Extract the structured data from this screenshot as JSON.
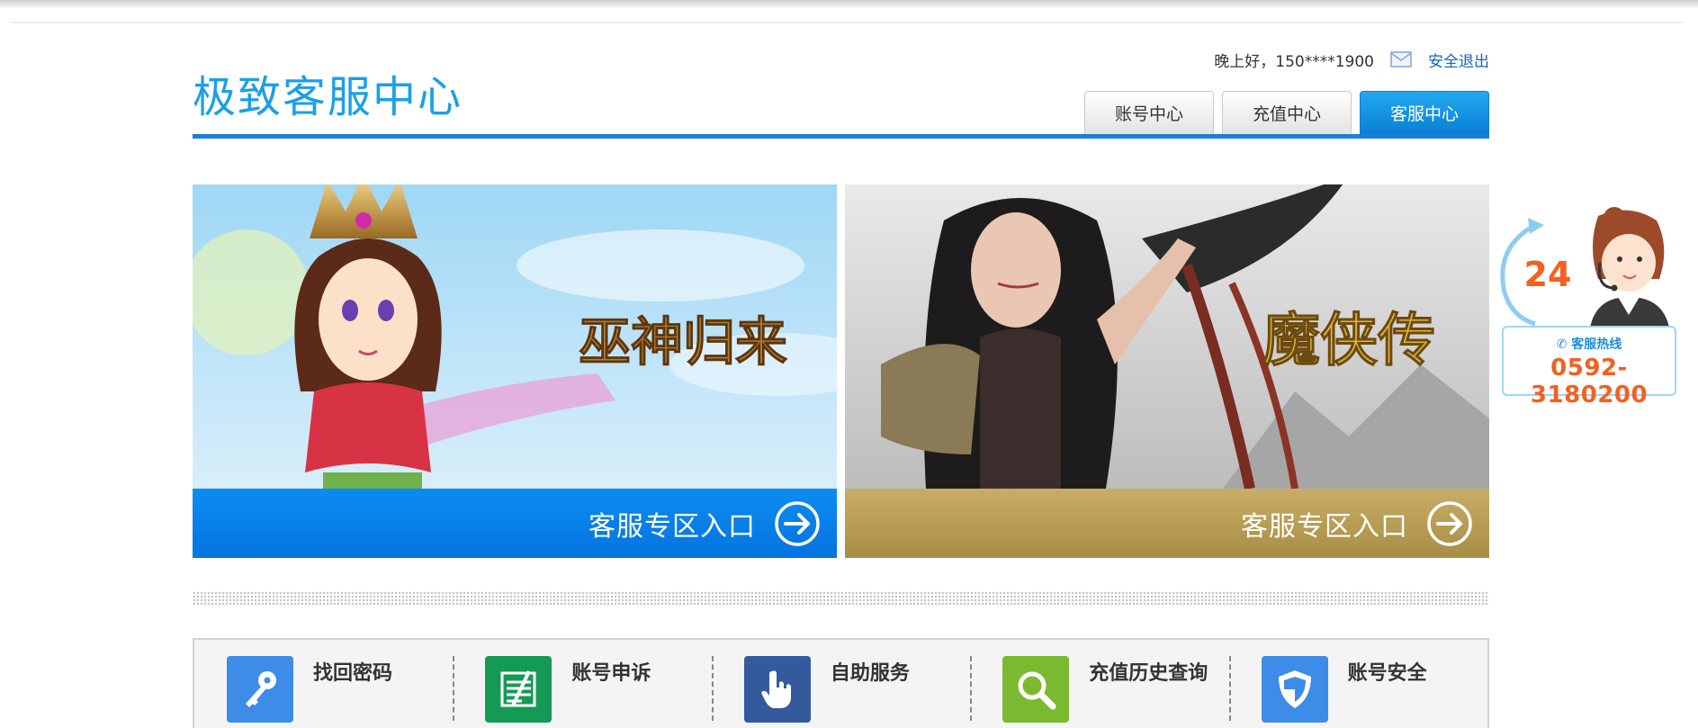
{
  "header": {
    "logo": "极致客服中心",
    "greeting": "晚上好，150****1900",
    "logout": "安全退出",
    "tabs": [
      {
        "label": "账号中心",
        "active": false
      },
      {
        "label": "充值中心",
        "active": false
      },
      {
        "label": "客服中心",
        "active": true
      }
    ]
  },
  "games": [
    {
      "title": "巫神归来",
      "entry_label": "客服专区入口",
      "accent": "#0a82ec"
    },
    {
      "title": "魔侠传",
      "entry_label": "客服专区入口",
      "accent": "#b89c52"
    }
  ],
  "services": [
    {
      "label": "找回密码",
      "icon": "key-icon",
      "color": "#3d8ce8"
    },
    {
      "label": "账号申诉",
      "icon": "document-icon",
      "color": "#159a55"
    },
    {
      "label": "自助服务",
      "icon": "hand-pointer-icon",
      "color": "#345a9e"
    },
    {
      "label": "充值历史查询",
      "icon": "magnifier-icon",
      "color": "#7bba30"
    },
    {
      "label": "账号安全",
      "icon": "shield-icon",
      "color": "#3d8ce8"
    }
  ],
  "hotline": {
    "badge": "24",
    "label": "客服热线",
    "number": "0592-3180200"
  }
}
